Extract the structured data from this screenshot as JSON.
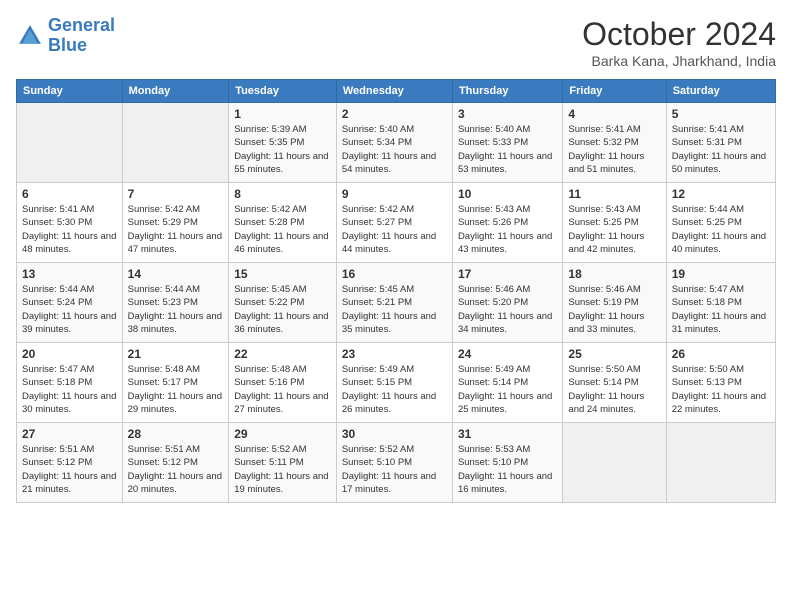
{
  "header": {
    "logo_line1": "General",
    "logo_line2": "Blue",
    "month": "October 2024",
    "location": "Barka Kana, Jharkhand, India"
  },
  "weekdays": [
    "Sunday",
    "Monday",
    "Tuesday",
    "Wednesday",
    "Thursday",
    "Friday",
    "Saturday"
  ],
  "weeks": [
    [
      {
        "day": "",
        "info": ""
      },
      {
        "day": "",
        "info": ""
      },
      {
        "day": "1",
        "info": "Sunrise: 5:39 AM\nSunset: 5:35 PM\nDaylight: 11 hours and 55 minutes."
      },
      {
        "day": "2",
        "info": "Sunrise: 5:40 AM\nSunset: 5:34 PM\nDaylight: 11 hours and 54 minutes."
      },
      {
        "day": "3",
        "info": "Sunrise: 5:40 AM\nSunset: 5:33 PM\nDaylight: 11 hours and 53 minutes."
      },
      {
        "day": "4",
        "info": "Sunrise: 5:41 AM\nSunset: 5:32 PM\nDaylight: 11 hours and 51 minutes."
      },
      {
        "day": "5",
        "info": "Sunrise: 5:41 AM\nSunset: 5:31 PM\nDaylight: 11 hours and 50 minutes."
      }
    ],
    [
      {
        "day": "6",
        "info": "Sunrise: 5:41 AM\nSunset: 5:30 PM\nDaylight: 11 hours and 48 minutes."
      },
      {
        "day": "7",
        "info": "Sunrise: 5:42 AM\nSunset: 5:29 PM\nDaylight: 11 hours and 47 minutes."
      },
      {
        "day": "8",
        "info": "Sunrise: 5:42 AM\nSunset: 5:28 PM\nDaylight: 11 hours and 46 minutes."
      },
      {
        "day": "9",
        "info": "Sunrise: 5:42 AM\nSunset: 5:27 PM\nDaylight: 11 hours and 44 minutes."
      },
      {
        "day": "10",
        "info": "Sunrise: 5:43 AM\nSunset: 5:26 PM\nDaylight: 11 hours and 43 minutes."
      },
      {
        "day": "11",
        "info": "Sunrise: 5:43 AM\nSunset: 5:25 PM\nDaylight: 11 hours and 42 minutes."
      },
      {
        "day": "12",
        "info": "Sunrise: 5:44 AM\nSunset: 5:25 PM\nDaylight: 11 hours and 40 minutes."
      }
    ],
    [
      {
        "day": "13",
        "info": "Sunrise: 5:44 AM\nSunset: 5:24 PM\nDaylight: 11 hours and 39 minutes."
      },
      {
        "day": "14",
        "info": "Sunrise: 5:44 AM\nSunset: 5:23 PM\nDaylight: 11 hours and 38 minutes."
      },
      {
        "day": "15",
        "info": "Sunrise: 5:45 AM\nSunset: 5:22 PM\nDaylight: 11 hours and 36 minutes."
      },
      {
        "day": "16",
        "info": "Sunrise: 5:45 AM\nSunset: 5:21 PM\nDaylight: 11 hours and 35 minutes."
      },
      {
        "day": "17",
        "info": "Sunrise: 5:46 AM\nSunset: 5:20 PM\nDaylight: 11 hours and 34 minutes."
      },
      {
        "day": "18",
        "info": "Sunrise: 5:46 AM\nSunset: 5:19 PM\nDaylight: 11 hours and 33 minutes."
      },
      {
        "day": "19",
        "info": "Sunrise: 5:47 AM\nSunset: 5:18 PM\nDaylight: 11 hours and 31 minutes."
      }
    ],
    [
      {
        "day": "20",
        "info": "Sunrise: 5:47 AM\nSunset: 5:18 PM\nDaylight: 11 hours and 30 minutes."
      },
      {
        "day": "21",
        "info": "Sunrise: 5:48 AM\nSunset: 5:17 PM\nDaylight: 11 hours and 29 minutes."
      },
      {
        "day": "22",
        "info": "Sunrise: 5:48 AM\nSunset: 5:16 PM\nDaylight: 11 hours and 27 minutes."
      },
      {
        "day": "23",
        "info": "Sunrise: 5:49 AM\nSunset: 5:15 PM\nDaylight: 11 hours and 26 minutes."
      },
      {
        "day": "24",
        "info": "Sunrise: 5:49 AM\nSunset: 5:14 PM\nDaylight: 11 hours and 25 minutes."
      },
      {
        "day": "25",
        "info": "Sunrise: 5:50 AM\nSunset: 5:14 PM\nDaylight: 11 hours and 24 minutes."
      },
      {
        "day": "26",
        "info": "Sunrise: 5:50 AM\nSunset: 5:13 PM\nDaylight: 11 hours and 22 minutes."
      }
    ],
    [
      {
        "day": "27",
        "info": "Sunrise: 5:51 AM\nSunset: 5:12 PM\nDaylight: 11 hours and 21 minutes."
      },
      {
        "day": "28",
        "info": "Sunrise: 5:51 AM\nSunset: 5:12 PM\nDaylight: 11 hours and 20 minutes."
      },
      {
        "day": "29",
        "info": "Sunrise: 5:52 AM\nSunset: 5:11 PM\nDaylight: 11 hours and 19 minutes."
      },
      {
        "day": "30",
        "info": "Sunrise: 5:52 AM\nSunset: 5:10 PM\nDaylight: 11 hours and 17 minutes."
      },
      {
        "day": "31",
        "info": "Sunrise: 5:53 AM\nSunset: 5:10 PM\nDaylight: 11 hours and 16 minutes."
      },
      {
        "day": "",
        "info": ""
      },
      {
        "day": "",
        "info": ""
      }
    ]
  ]
}
